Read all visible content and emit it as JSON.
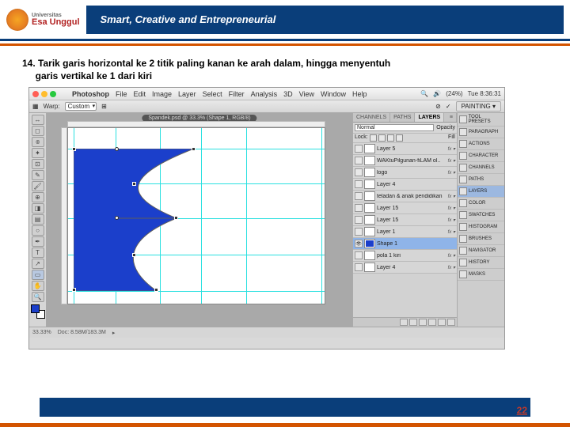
{
  "header": {
    "brand_top": "Universitas",
    "brand": "Esa Unggul",
    "tagline": "Smart, Creative and Entrepreneurial"
  },
  "instruction": {
    "num": "14.",
    "text_a": "Tarik garis horizontal ke 2 titik paling kanan ke arah dalam, hingga menyentuh",
    "text_b": "garis vertikal ke 1 dari kiri"
  },
  "mac": {
    "menus": [
      "Photoshop",
      "File",
      "Edit",
      "Image",
      "Layer",
      "Select",
      "Filter",
      "Analysis",
      "3D",
      "View",
      "Window",
      "Help"
    ],
    "right": [
      "(24%)",
      "Tue 8:36:31"
    ]
  },
  "options": {
    "label": "Warp:",
    "value": "Custom",
    "painting": "PAINTING ▾"
  },
  "doc_tab": "Spandek.psd @ 33.3% (Shape 1, RGB/8)",
  "panels": {
    "tabs": [
      "CHANNELS",
      "PATHS",
      "LAYERS"
    ],
    "blend": "Normal",
    "opacity": "Opacity",
    "fill": "Fill",
    "lock_label": "Lock:"
  },
  "layers": [
    {
      "vis": "",
      "name": "Layer 5",
      "fx": "fx"
    },
    {
      "vis": "",
      "name": "WAKtuPilgunan-fiLAM ol..",
      "fx": "fx"
    },
    {
      "vis": "",
      "name": "logo",
      "fx": "fx"
    },
    {
      "vis": "",
      "name": "Layer 4",
      "fx": ""
    },
    {
      "vis": "",
      "name": "teladan & anak pendidikan",
      "fx": "fx"
    },
    {
      "vis": "",
      "name": "Layer 15",
      "fx": "fx"
    },
    {
      "vis": "",
      "name": "Layer 15",
      "fx": "fx"
    },
    {
      "vis": "",
      "name": "Layer 1",
      "fx": "fx"
    },
    {
      "vis": "👁",
      "name": "Shape 1",
      "fx": "",
      "sel": true,
      "blue": true
    },
    {
      "vis": "",
      "name": "pola 1 kiri",
      "fx": "fx"
    },
    {
      "vis": "",
      "name": "Layer 4",
      "fx": "fx"
    }
  ],
  "strip": [
    "TOOL PRESETS",
    "PARAGRAPH",
    "ACTIONS",
    "CHARACTER",
    "CHANNELS",
    "PATHS",
    "LAYERS",
    "COLOR",
    "SWATCHES",
    "HISTOGRAM",
    "BRUSHES",
    "NAVIGATOR",
    "HISTORY",
    "MASKS"
  ],
  "strip_active": "LAYERS",
  "status": {
    "zoom": "33.33%",
    "doc": "Doc: 8.58M/183.3M"
  },
  "page_num": "22"
}
